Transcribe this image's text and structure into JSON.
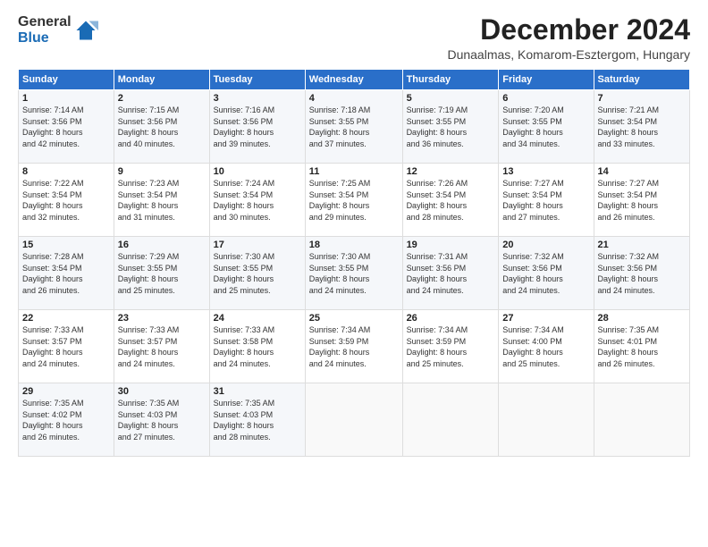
{
  "header": {
    "logo_line1": "General",
    "logo_line2": "Blue",
    "month": "December 2024",
    "location": "Dunaalmas, Komarom-Esztergom, Hungary"
  },
  "days_of_week": [
    "Sunday",
    "Monday",
    "Tuesday",
    "Wednesday",
    "Thursday",
    "Friday",
    "Saturday"
  ],
  "weeks": [
    [
      {
        "day": "1",
        "info": "Sunrise: 7:14 AM\nSunset: 3:56 PM\nDaylight: 8 hours\nand 42 minutes."
      },
      {
        "day": "2",
        "info": "Sunrise: 7:15 AM\nSunset: 3:56 PM\nDaylight: 8 hours\nand 40 minutes."
      },
      {
        "day": "3",
        "info": "Sunrise: 7:16 AM\nSunset: 3:56 PM\nDaylight: 8 hours\nand 39 minutes."
      },
      {
        "day": "4",
        "info": "Sunrise: 7:18 AM\nSunset: 3:55 PM\nDaylight: 8 hours\nand 37 minutes."
      },
      {
        "day": "5",
        "info": "Sunrise: 7:19 AM\nSunset: 3:55 PM\nDaylight: 8 hours\nand 36 minutes."
      },
      {
        "day": "6",
        "info": "Sunrise: 7:20 AM\nSunset: 3:55 PM\nDaylight: 8 hours\nand 34 minutes."
      },
      {
        "day": "7",
        "info": "Sunrise: 7:21 AM\nSunset: 3:54 PM\nDaylight: 8 hours\nand 33 minutes."
      }
    ],
    [
      {
        "day": "8",
        "info": "Sunrise: 7:22 AM\nSunset: 3:54 PM\nDaylight: 8 hours\nand 32 minutes."
      },
      {
        "day": "9",
        "info": "Sunrise: 7:23 AM\nSunset: 3:54 PM\nDaylight: 8 hours\nand 31 minutes."
      },
      {
        "day": "10",
        "info": "Sunrise: 7:24 AM\nSunset: 3:54 PM\nDaylight: 8 hours\nand 30 minutes."
      },
      {
        "day": "11",
        "info": "Sunrise: 7:25 AM\nSunset: 3:54 PM\nDaylight: 8 hours\nand 29 minutes."
      },
      {
        "day": "12",
        "info": "Sunrise: 7:26 AM\nSunset: 3:54 PM\nDaylight: 8 hours\nand 28 minutes."
      },
      {
        "day": "13",
        "info": "Sunrise: 7:27 AM\nSunset: 3:54 PM\nDaylight: 8 hours\nand 27 minutes."
      },
      {
        "day": "14",
        "info": "Sunrise: 7:27 AM\nSunset: 3:54 PM\nDaylight: 8 hours\nand 26 minutes."
      }
    ],
    [
      {
        "day": "15",
        "info": "Sunrise: 7:28 AM\nSunset: 3:54 PM\nDaylight: 8 hours\nand 26 minutes."
      },
      {
        "day": "16",
        "info": "Sunrise: 7:29 AM\nSunset: 3:55 PM\nDaylight: 8 hours\nand 25 minutes."
      },
      {
        "day": "17",
        "info": "Sunrise: 7:30 AM\nSunset: 3:55 PM\nDaylight: 8 hours\nand 25 minutes."
      },
      {
        "day": "18",
        "info": "Sunrise: 7:30 AM\nSunset: 3:55 PM\nDaylight: 8 hours\nand 24 minutes."
      },
      {
        "day": "19",
        "info": "Sunrise: 7:31 AM\nSunset: 3:56 PM\nDaylight: 8 hours\nand 24 minutes."
      },
      {
        "day": "20",
        "info": "Sunrise: 7:32 AM\nSunset: 3:56 PM\nDaylight: 8 hours\nand 24 minutes."
      },
      {
        "day": "21",
        "info": "Sunrise: 7:32 AM\nSunset: 3:56 PM\nDaylight: 8 hours\nand 24 minutes."
      }
    ],
    [
      {
        "day": "22",
        "info": "Sunrise: 7:33 AM\nSunset: 3:57 PM\nDaylight: 8 hours\nand 24 minutes."
      },
      {
        "day": "23",
        "info": "Sunrise: 7:33 AM\nSunset: 3:57 PM\nDaylight: 8 hours\nand 24 minutes."
      },
      {
        "day": "24",
        "info": "Sunrise: 7:33 AM\nSunset: 3:58 PM\nDaylight: 8 hours\nand 24 minutes."
      },
      {
        "day": "25",
        "info": "Sunrise: 7:34 AM\nSunset: 3:59 PM\nDaylight: 8 hours\nand 24 minutes."
      },
      {
        "day": "26",
        "info": "Sunrise: 7:34 AM\nSunset: 3:59 PM\nDaylight: 8 hours\nand 25 minutes."
      },
      {
        "day": "27",
        "info": "Sunrise: 7:34 AM\nSunset: 4:00 PM\nDaylight: 8 hours\nand 25 minutes."
      },
      {
        "day": "28",
        "info": "Sunrise: 7:35 AM\nSunset: 4:01 PM\nDaylight: 8 hours\nand 26 minutes."
      }
    ],
    [
      {
        "day": "29",
        "info": "Sunrise: 7:35 AM\nSunset: 4:02 PM\nDaylight: 8 hours\nand 26 minutes."
      },
      {
        "day": "30",
        "info": "Sunrise: 7:35 AM\nSunset: 4:03 PM\nDaylight: 8 hours\nand 27 minutes."
      },
      {
        "day": "31",
        "info": "Sunrise: 7:35 AM\nSunset: 4:03 PM\nDaylight: 8 hours\nand 28 minutes."
      },
      null,
      null,
      null,
      null
    ]
  ]
}
